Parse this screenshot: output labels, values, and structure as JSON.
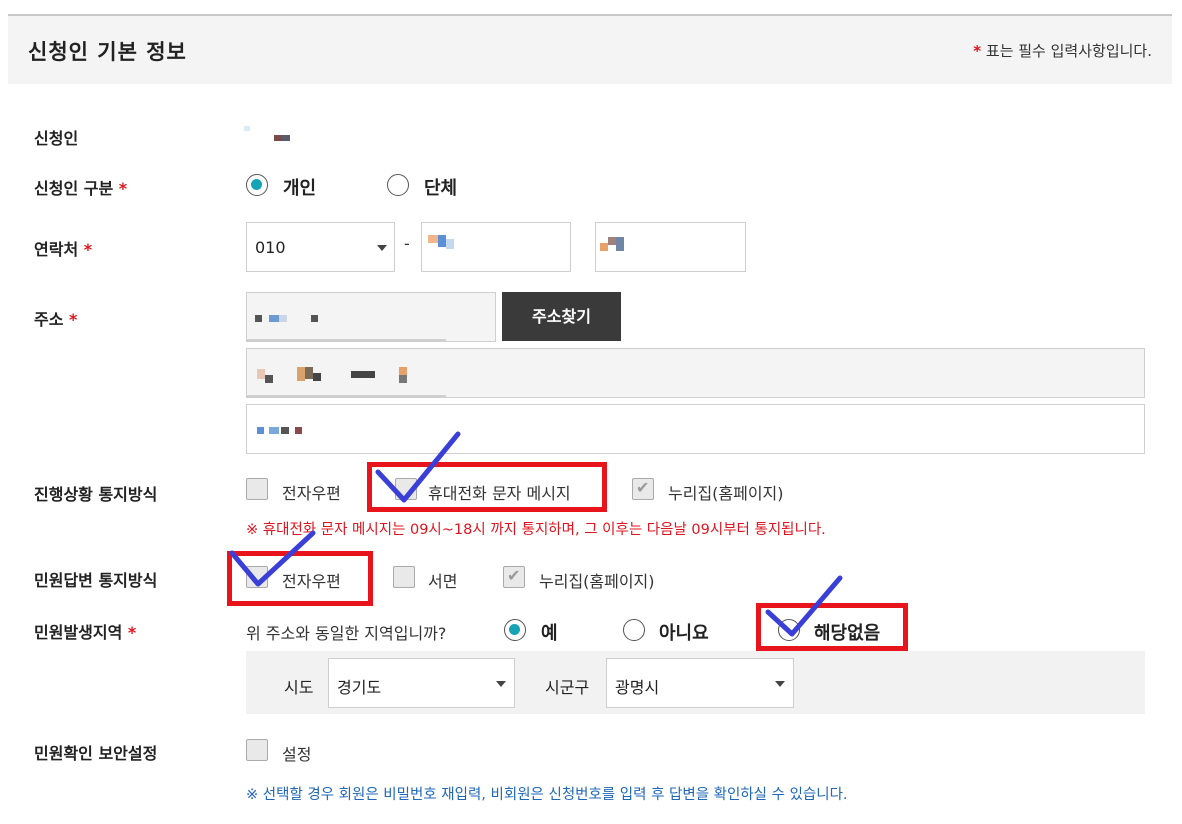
{
  "header": {
    "title": "신청인 기본 정보",
    "required_mark": "*",
    "required_note": "표는 필수 입력사항입니다."
  },
  "applicant": {
    "label": "신청인"
  },
  "applicant_type": {
    "label": "신청인 구분",
    "required_mark": "*",
    "options": [
      {
        "label": "개인",
        "selected": true
      },
      {
        "label": "단체",
        "selected": false
      }
    ]
  },
  "contact": {
    "label": "연락처",
    "required_mark": "*",
    "prefix_value": "010",
    "separator": "-"
  },
  "address": {
    "label": "주소",
    "required_mark": "*",
    "search_button": "주소찾기"
  },
  "progress_notice": {
    "label": "진행상황 통지방식",
    "options": [
      {
        "label": "전자우편",
        "checked": false
      },
      {
        "label": "휴대전화 문자 메시지",
        "checked": false
      },
      {
        "label": "누리집(홈페이지)",
        "checked": true
      }
    ],
    "note": "※ 휴대전화 문자 메시지는 09시~18시 까지 통지하며, 그 이후는 다음날 09시부터 통지됩니다."
  },
  "answer_notice": {
    "label": "민원답변 통지방식",
    "options": [
      {
        "label": "전자우편",
        "checked": false
      },
      {
        "label": "서면",
        "checked": false
      },
      {
        "label": "누리집(홈페이지)",
        "checked": true
      }
    ]
  },
  "region": {
    "label": "민원발생지역",
    "required_mark": "*",
    "question": "위 주소와 동일한 지역입니까?",
    "options": [
      {
        "label": "예",
        "selected": true
      },
      {
        "label": "아니요",
        "selected": false
      },
      {
        "label": "해당없음",
        "selected": false
      }
    ],
    "sido_label": "시도",
    "sido_value": "경기도",
    "sigungu_label": "시군구",
    "sigungu_value": "광명시"
  },
  "security": {
    "label": "민원확인 보안설정",
    "checkbox_label": "설정",
    "note": "※ 선택할 경우 회원은 비밀번호 재입력, 비회원은 신청번호를 입력 후 답변을 확인하실 수 있습니다."
  },
  "colors": {
    "accent_radio": "#17a3b6",
    "required_red": "#e0141f",
    "note_blue": "#1f67b8",
    "annotation_red": "#e8141b",
    "annotation_check": "#3a3fd8"
  }
}
